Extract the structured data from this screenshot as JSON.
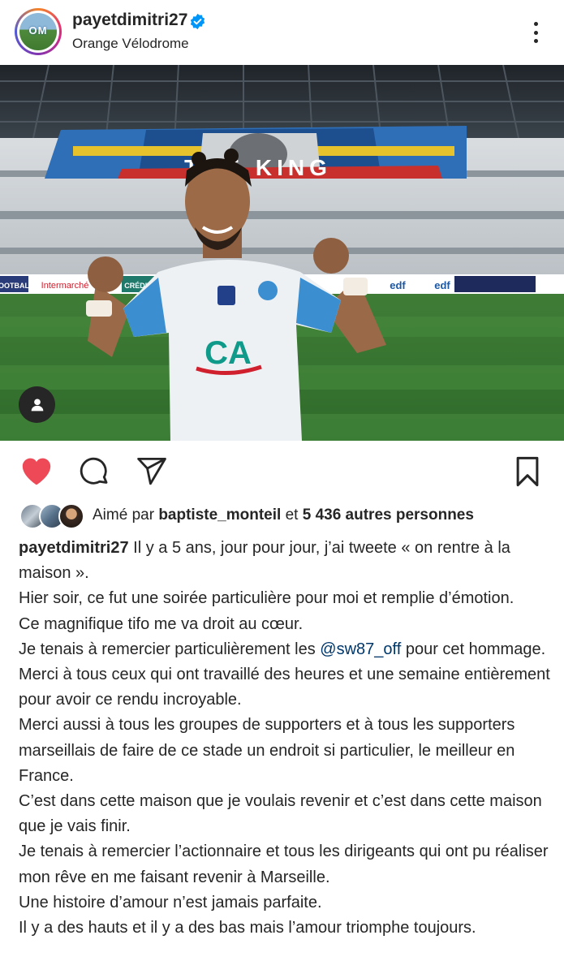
{
  "header": {
    "avatar_text": "OM",
    "username": "payetdimitri27",
    "verified": true,
    "location": "Orange Vélodrome"
  },
  "photo": {
    "banner_text": "THE KING",
    "ad_boards": [
      "FOOTBALL",
      "Intermarché",
      "CRÉDIT",
      "edf",
      "edf"
    ]
  },
  "actions": {
    "liked": true,
    "like_color": "#ed4956"
  },
  "likes": {
    "prefix": "Aimé par",
    "first_liker": "baptiste_monteil",
    "connector": "et",
    "others": "5 436 autres personnes"
  },
  "caption": {
    "username": "payetdimitri27",
    "lines": [
      "Il y a 5 ans, jour pour jour, j’ai tweete « on rentre à la maison ».",
      "Hier soir, ce fut une soirée particulière pour moi et remplie d’émotion.",
      "Ce magnifique tifo me va droit au cœur.",
      "Je tenais à remercier particulièrement les",
      "pour cet hommage.",
      "Merci à tous ceux qui ont travaillé des heures et une semaine entièrement pour avoir ce rendu incroyable.",
      "Merci aussi à tous les groupes de supporters et à tous les supporters marseillais de faire de ce stade un endroit si particulier, le meilleur en France.",
      "C’est dans cette maison que je voulais revenir et c’est dans cette maison que je vais finir.",
      "Je tenais à remercier l’actionnaire et tous les dirigeants qui ont pu réaliser mon rêve en me faisant revenir à Marseille.",
      "Une histoire d’amour n’est jamais parfaite.",
      "Il y a des hauts et il y a des bas mais l’amour triomphe toujours."
    ],
    "mention": "@sw87_off",
    "mention_color": "#00376b"
  }
}
